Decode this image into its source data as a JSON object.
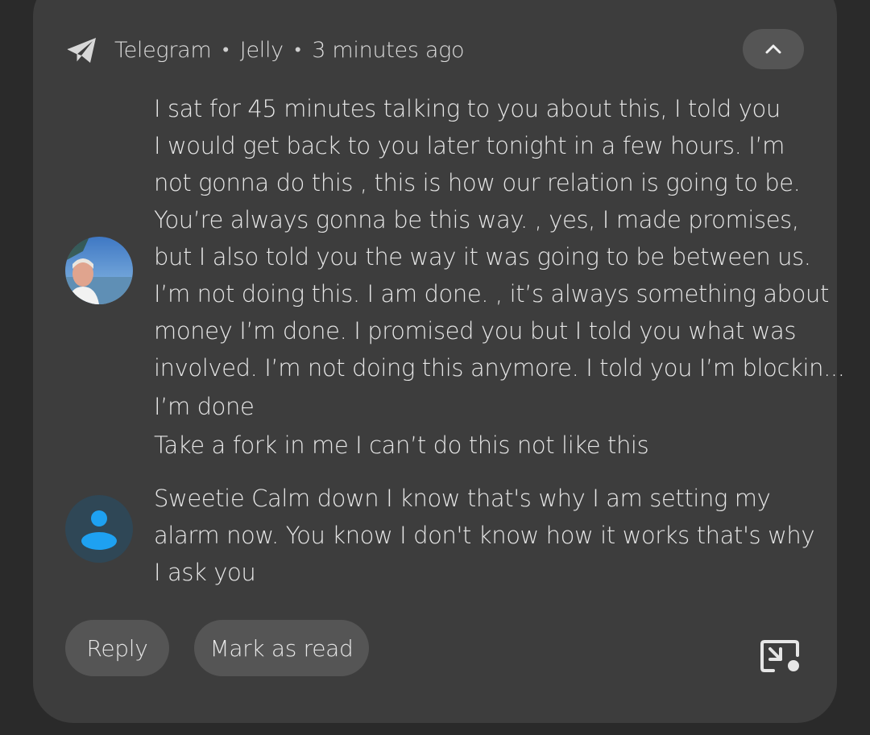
{
  "notification": {
    "app_name": "Telegram",
    "separator": "•",
    "sender": "Jelly",
    "time": "3 minutes ago",
    "icons": {
      "app": "telegram-paper-plane-icon",
      "collapse": "chevron-up-icon",
      "pip": "picture-in-picture-icon"
    }
  },
  "messages": [
    {
      "avatar": "contact-photo",
      "lines": [
        "I sat for 45 minutes talking to you about this, I told you",
        "I would get back to you later tonight in a few hours. I’m",
        "not gonna do this , this is how our relation is going to be.",
        "You’re always gonna be this way. , yes, I made promises,",
        "but I also told you the way it was going to be between us.",
        "I’m not doing this. I am done. , it’s always something about",
        "money I’m done. I promised you but I told you what was",
        "involved. I’m not doing this anymore. I told you I’m blockin...",
        "I’m done",
        "Take a fork in me I can’t do this not like this"
      ]
    },
    {
      "avatar": "default-person-icon",
      "lines": [
        "Sweetie Calm down I know that's why I am setting my",
        "alarm now. You know I don't know how it works that's why",
        "I ask you"
      ]
    }
  ],
  "actions": {
    "reply": "Reply",
    "mark_as_read": "Mark as read"
  },
  "colors": {
    "card": "#3d3d3d",
    "button": "#555555",
    "text": "#e6e6e6",
    "avatar_accent": "#1ea1f1"
  }
}
